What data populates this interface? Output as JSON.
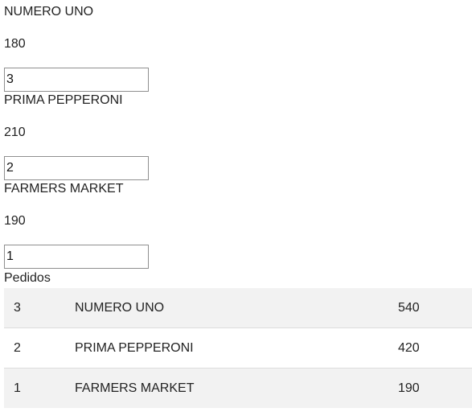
{
  "products": [
    {
      "name": "NUMERO UNO",
      "price": "180",
      "quantity": "3"
    },
    {
      "name": "PRIMA PEPPERONI",
      "price": "210",
      "quantity": "2"
    },
    {
      "name": "FARMERS MARKET",
      "price": "190",
      "quantity": "1"
    }
  ],
  "orders": {
    "label": "Pedidos",
    "rows": [
      {
        "qty": "3",
        "name": "NUMERO UNO",
        "total": "540"
      },
      {
        "qty": "2",
        "name": "PRIMA PEPPERONI",
        "total": "420"
      },
      {
        "qty": "1",
        "name": "FARMERS MARKET",
        "total": "190"
      }
    ]
  }
}
